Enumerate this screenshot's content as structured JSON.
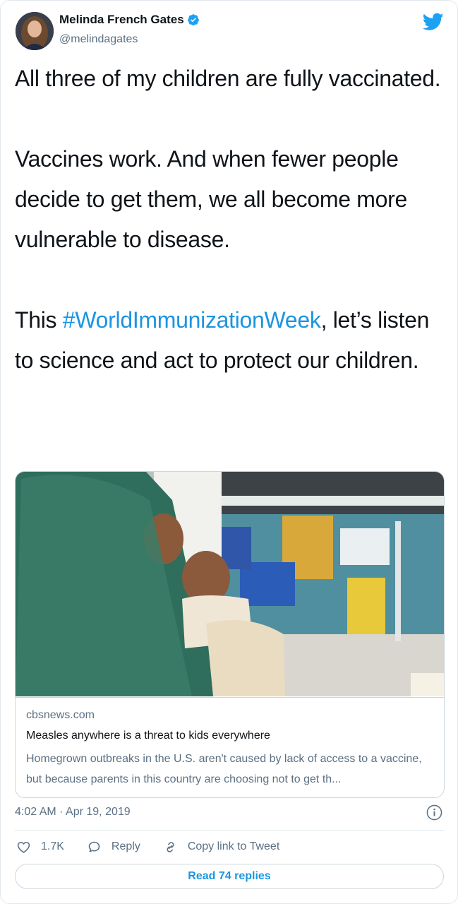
{
  "author": {
    "name": "Melinda French Gates",
    "handle": "@melindagates"
  },
  "tweet": {
    "paragraphs": [
      "All three of my children are fully vaccinated.",
      "Vaccines work. And when fewer people decide to get them, we all become more vulnerable to disease."
    ],
    "p3_before": "This ",
    "hashtag": "#WorldImmunizationWeek",
    "p3_after": ", let’s listen to science and act to protect our children."
  },
  "link_card": {
    "domain": "cbsnews.com",
    "title": "Measles anywhere is a threat to kids everywhere",
    "description": "Homegrown outbreaks in the U.S. aren't caused by lack of access to a vaccine, but because parents in this country are choosing not to get th..."
  },
  "meta": {
    "timestamp": "4:02 AM · Apr 19, 2019"
  },
  "actions": {
    "likes": "1.7K",
    "reply_label": "Reply",
    "copy_link_label": "Copy link to Tweet"
  },
  "read_replies_label": "Read 74 replies",
  "icons": [
    "verified-badge-icon",
    "twitter-bird-icon",
    "info-icon",
    "heart-icon",
    "reply-icon",
    "link-icon"
  ],
  "colors": {
    "accent": "#1b95e0",
    "secondary_text": "#5b7083",
    "border": "#ccd6dd"
  }
}
